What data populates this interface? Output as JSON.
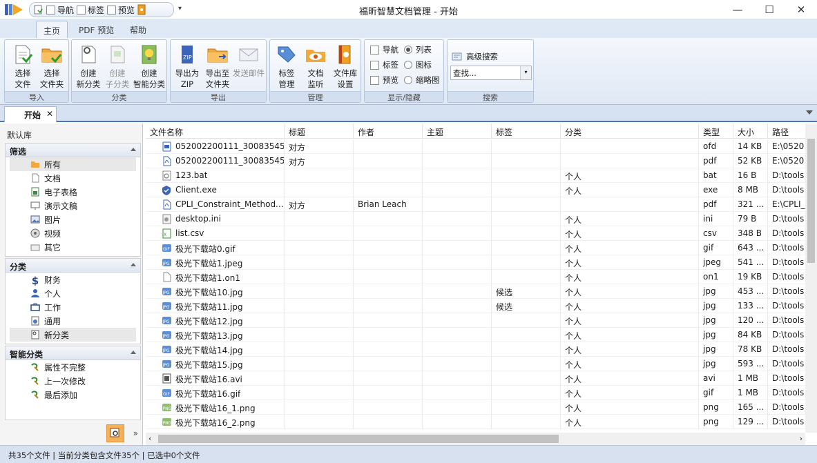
{
  "titlebar": {
    "title": "福昕智慧文档管理 - 开始",
    "qat": {
      "nav_label": "导航",
      "tag_label": "标签",
      "preview_label": "预览",
      "dropdown": "▾"
    },
    "minimize": "—",
    "maximize": "☐",
    "close": "✕"
  },
  "ribbon_tabs": [
    "主页",
    "PDF 预览",
    "帮助"
  ],
  "ribbon": {
    "import": {
      "caption": "导入",
      "buttons": [
        {
          "l1": "选择",
          "l2": "文件"
        },
        {
          "l1": "选择",
          "l2": "文件夹"
        }
      ]
    },
    "category": {
      "caption": "分类",
      "buttons": [
        {
          "l1": "创建",
          "l2": "新分类"
        },
        {
          "l1": "创建",
          "l2": "子分类"
        },
        {
          "l1": "创建",
          "l2": "智能分类"
        }
      ]
    },
    "export": {
      "caption": "导出",
      "buttons": [
        {
          "l1": "导出为",
          "l2": "ZIP"
        },
        {
          "l1": "导出至",
          "l2": "文件夹"
        },
        {
          "l1": "发送邮件",
          "l2": ""
        }
      ]
    },
    "manage": {
      "caption": "管理",
      "buttons": [
        {
          "l1": "标签",
          "l2": "管理"
        },
        {
          "l1": "文档",
          "l2": "监听"
        },
        {
          "l1": "文件库",
          "l2": "设置"
        }
      ]
    },
    "display": {
      "caption": "显示/隐藏",
      "nav": "导航",
      "tag": "标签",
      "preview": "预览",
      "list": "列表",
      "icon": "图标",
      "thumb": "缩略图"
    },
    "search": {
      "caption": "搜索",
      "advanced": "高级搜索",
      "placeholder": "查找..."
    }
  },
  "doc_tab": {
    "label": "开始",
    "close": "✕"
  },
  "left_panel": {
    "library": "默认库",
    "filter": {
      "title": "筛选",
      "items": [
        "所有",
        "文档",
        "电子表格",
        "演示文稿",
        "图片",
        "视频",
        "其它"
      ]
    },
    "categories": {
      "title": "分类",
      "items": [
        "财务",
        "个人",
        "工作",
        "通用",
        "新分类"
      ]
    },
    "smart": {
      "title": "智能分类",
      "items": [
        "属性不完整",
        "上一次修改",
        "最后添加"
      ]
    },
    "expand": "»"
  },
  "columns": [
    "文件名称",
    "标题",
    "作者",
    "主题",
    "标签",
    "分类",
    "类型",
    "大小",
    "路径"
  ],
  "files": [
    {
      "name": "052002200111_30083545...",
      "title": "对方",
      "author": "",
      "subject": "",
      "tag": "",
      "category": "",
      "type": "ofd",
      "size": "14 KB",
      "path": "E:\\0520",
      "icon": "ofd"
    },
    {
      "name": "052002200111_30083545...",
      "title": "对方",
      "author": "",
      "subject": "",
      "tag": "",
      "category": "",
      "type": "pdf",
      "size": "52 KB",
      "path": "E:\\0520",
      "icon": "pdf"
    },
    {
      "name": "123.bat",
      "title": "",
      "author": "",
      "subject": "",
      "tag": "",
      "category": "个人",
      "type": "bat",
      "size": "16 B",
      "path": "D:\\tools",
      "icon": "bat"
    },
    {
      "name": "Client.exe",
      "title": "",
      "author": "",
      "subject": "",
      "tag": "",
      "category": "个人",
      "type": "exe",
      "size": "8 MB",
      "path": "D:\\tools",
      "icon": "exe"
    },
    {
      "name": "CPLI_Constraint_Method....",
      "title": "对方",
      "author": "Brian Leach",
      "subject": "",
      "tag": "",
      "category": "",
      "type": "pdf",
      "size": "321 ...",
      "path": "E:\\CPLI_",
      "icon": "pdf"
    },
    {
      "name": "desktop.ini",
      "title": "",
      "author": "",
      "subject": "",
      "tag": "",
      "category": "个人",
      "type": "ini",
      "size": "79 B",
      "path": "D:\\tools",
      "icon": "ini"
    },
    {
      "name": "list.csv",
      "title": "",
      "author": "",
      "subject": "",
      "tag": "",
      "category": "个人",
      "type": "csv",
      "size": "348 B",
      "path": "D:\\tools",
      "icon": "csv"
    },
    {
      "name": "极光下载站0.gif",
      "title": "",
      "author": "",
      "subject": "",
      "tag": "",
      "category": "个人",
      "type": "gif",
      "size": "643 ...",
      "path": "D:\\tools",
      "icon": "gif"
    },
    {
      "name": "极光下载站1.jpeg",
      "title": "",
      "author": "",
      "subject": "",
      "tag": "",
      "category": "个人",
      "type": "jpeg",
      "size": "541 ...",
      "path": "D:\\tools",
      "icon": "jpg"
    },
    {
      "name": "极光下载站1.on1",
      "title": "",
      "author": "",
      "subject": "",
      "tag": "",
      "category": "个人",
      "type": "on1",
      "size": "19 KB",
      "path": "D:\\tools",
      "icon": "blank"
    },
    {
      "name": "极光下载站10.jpg",
      "title": "",
      "author": "",
      "subject": "",
      "tag": "候选",
      "category": "个人",
      "type": "jpg",
      "size": "453 ...",
      "path": "D:\\tools",
      "icon": "jpg"
    },
    {
      "name": "极光下载站11.jpg",
      "title": "",
      "author": "",
      "subject": "",
      "tag": "候选",
      "category": "个人",
      "type": "jpg",
      "size": "133 ...",
      "path": "D:\\tools",
      "icon": "jpg"
    },
    {
      "name": "极光下载站12.jpg",
      "title": "",
      "author": "",
      "subject": "",
      "tag": "",
      "category": "个人",
      "type": "jpg",
      "size": "120 ...",
      "path": "D:\\tools",
      "icon": "jpg"
    },
    {
      "name": "极光下载站13.jpg",
      "title": "",
      "author": "",
      "subject": "",
      "tag": "",
      "category": "个人",
      "type": "jpg",
      "size": "84 KB",
      "path": "D:\\tools",
      "icon": "jpg"
    },
    {
      "name": "极光下载站14.jpg",
      "title": "",
      "author": "",
      "subject": "",
      "tag": "",
      "category": "个人",
      "type": "jpg",
      "size": "78 KB",
      "path": "D:\\tools",
      "icon": "jpg"
    },
    {
      "name": "极光下载站15.jpg",
      "title": "",
      "author": "",
      "subject": "",
      "tag": "",
      "category": "个人",
      "type": "jpg",
      "size": "593 ...",
      "path": "D:\\tools",
      "icon": "jpg"
    },
    {
      "name": "极光下载站16.avi",
      "title": "",
      "author": "",
      "subject": "",
      "tag": "",
      "category": "个人",
      "type": "avi",
      "size": "1 MB",
      "path": "D:\\tools",
      "icon": "avi"
    },
    {
      "name": "极光下载站16.gif",
      "title": "",
      "author": "",
      "subject": "",
      "tag": "",
      "category": "个人",
      "type": "gif",
      "size": "1 MB",
      "path": "D:\\tools",
      "icon": "gif"
    },
    {
      "name": "极光下载站16_1.png",
      "title": "",
      "author": "",
      "subject": "",
      "tag": "",
      "category": "个人",
      "type": "png",
      "size": "165 ...",
      "path": "D:\\tools",
      "icon": "png"
    },
    {
      "name": "极光下载站16_2.png",
      "title": "",
      "author": "",
      "subject": "",
      "tag": "",
      "category": "个人",
      "type": "png",
      "size": "129 ...",
      "path": "D:\\tools",
      "icon": "png"
    }
  ],
  "status": "共35个文件 | 当前分类包含文件35个 | 已选中0个文件",
  "colors": {
    "accent": "#4b76b8",
    "ribbon_bg": "#dfe8f5",
    "status_bg": "#d7e1ef",
    "jpg_icon": "#5b8fd6",
    "png_icon": "#8dc06b"
  }
}
